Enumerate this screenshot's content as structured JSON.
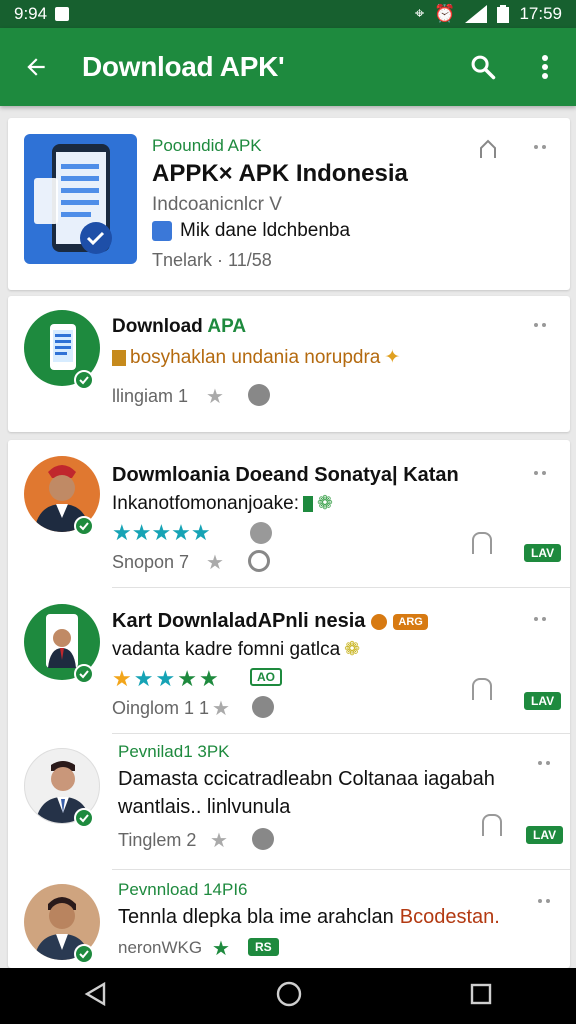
{
  "status_bar": {
    "time_left": "9:94",
    "time_right": "17:59"
  },
  "app_bar": {
    "title": "Download APK'"
  },
  "top_card": {
    "kicker": "Pooundid APK",
    "title": "APPK× APK Indonesia",
    "subtitle": "Indcoanicnlcr V",
    "feature": "Mik dane ldchbenba",
    "meta": "Tnelark · 11/58"
  },
  "second_card": {
    "title_prefix": "Download ",
    "title_accent": "APA",
    "description": "bosyhaklan undania norupdra",
    "meta": "llingiam 1"
  },
  "list_items": [
    {
      "title": "Dowmloania Doeand Sonatya| Katan",
      "description": "Inkanotfomonanjoake:",
      "rating": "★★★★★",
      "meta": "Snopon 7",
      "badge": "LAV"
    },
    {
      "title": "Kart DownlaladAPnli nesia",
      "tag": "ARG",
      "description": "vadanta kadre fomni gatlca",
      "rating": "★★★★★",
      "rating_badge": "AO",
      "meta": "Oinglom 1 1",
      "badge": "LAV"
    },
    {
      "kicker": "Pevnilad1 3PK",
      "title": "Damasta ccicatradleabn Coltanaa iagabah",
      "description": "wantlais.. linlvunula",
      "meta": "Tinglem 2",
      "badge": "LAV"
    },
    {
      "kicker": "Pevnnload 14PI6",
      "title": "Tennla dlepka bla ime arahclan",
      "title_accent": "Bcodestan.",
      "meta": "neronWKG",
      "rating_badge": "RS"
    }
  ],
  "colors": {
    "primary": "#1e8a3e",
    "status_bar": "#17602f",
    "star_gold": "#f2a51a",
    "star_teal": "#16a3b5"
  }
}
